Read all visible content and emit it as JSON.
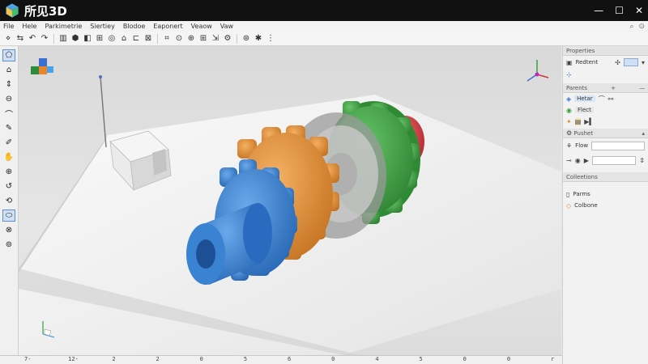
{
  "app": {
    "title": "所见3D"
  },
  "window": {
    "minimize": "—",
    "maximize": "☐",
    "close": "✕"
  },
  "menu": [
    {
      "label": "File",
      "name": "menu-file"
    },
    {
      "label": "Hele",
      "name": "menu-hele"
    },
    {
      "label": "Parkimetrie",
      "name": "menu-parkimetrie"
    },
    {
      "label": "Siertiey",
      "name": "menu-siertiey"
    },
    {
      "label": "Blodoe",
      "name": "menu-blodoe"
    },
    {
      "label": "Eaponert",
      "name": "menu-eaponert"
    },
    {
      "label": "Veaow",
      "name": "menu-veaow"
    },
    {
      "label": "Vaw",
      "name": "menu-vaw"
    }
  ],
  "menu_right": {
    "search_icon": "⌕",
    "pin_icon": "⊙"
  },
  "toolbar": [
    {
      "glyph": "⋄",
      "name": "select-tool-icon"
    },
    {
      "glyph": "⇆",
      "name": "move-tool-icon"
    },
    {
      "glyph": "↶",
      "name": "undo-icon"
    },
    {
      "glyph": "↷",
      "name": "redo-icon"
    },
    {
      "glyph": "▥",
      "name": "grid-icon"
    },
    {
      "glyph": "⬢",
      "name": "solid-icon"
    },
    {
      "glyph": "◧",
      "name": "shade-icon"
    },
    {
      "glyph": "⊞",
      "name": "layout-icon"
    },
    {
      "glyph": "◎",
      "name": "orbit-icon"
    },
    {
      "glyph": "⌂",
      "name": "home-view-icon"
    },
    {
      "glyph": "⊏",
      "name": "frame-icon"
    },
    {
      "glyph": "⊠",
      "name": "bounding-box-icon"
    },
    {
      "glyph": "⌗",
      "name": "mesh-icon"
    },
    {
      "glyph": "⊙",
      "name": "target-icon"
    },
    {
      "glyph": "⊕",
      "name": "add-point-icon"
    },
    {
      "glyph": "⊞",
      "name": "snap-icon"
    },
    {
      "glyph": "⇲",
      "name": "scale-icon"
    },
    {
      "glyph": "⚙",
      "name": "settings-icon"
    },
    {
      "glyph": "⊛",
      "name": "gear-icon"
    },
    {
      "glyph": "✱",
      "name": "light-icon"
    },
    {
      "glyph": "⋮",
      "name": "more-icon"
    }
  ],
  "left_tools": [
    {
      "glyph": "⬠",
      "name": "select-shape-icon",
      "active": true
    },
    {
      "glyph": "⌂",
      "name": "home-icon"
    },
    {
      "glyph": "⇕",
      "name": "pan-icon"
    },
    {
      "glyph": "⊖",
      "name": "zoom-out-icon"
    },
    {
      "glyph": "⌒",
      "name": "arc-icon"
    },
    {
      "glyph": "✎",
      "name": "sketch-icon"
    },
    {
      "glyph": "✐",
      "name": "pen-icon"
    },
    {
      "glyph": "✋",
      "name": "hand-icon"
    },
    {
      "glyph": "⊕",
      "name": "zoom-in-icon"
    },
    {
      "glyph": "↺",
      "name": "rotate-icon"
    },
    {
      "glyph": "⟲",
      "name": "orbit-left-icon"
    },
    {
      "glyph": "⬭",
      "name": "ellipse-icon",
      "active": true
    },
    {
      "glyph": "⊗",
      "name": "section-icon"
    },
    {
      "glyph": "⊚",
      "name": "render-icon"
    }
  ],
  "panel": {
    "properties_header": "Properties",
    "section1_label": "Redtent",
    "section1_btn": "▾",
    "parents_header": "Parents",
    "parent_rows": [
      {
        "label": "Hetar",
        "name": "parent-row-hetar"
      },
      {
        "label": "Flect",
        "name": "parent-row-flect"
      }
    ],
    "pushet_label": "Pushet",
    "flow_label": "Flow",
    "collections_header": "Colleetions",
    "collections": [
      {
        "label": "Parms",
        "name": "collection-parms"
      },
      {
        "label": "Colbone",
        "name": "collection-colbone"
      }
    ],
    "plus": "+",
    "dash": "—",
    "caret": "▴"
  },
  "ruler": [
    "7-",
    "12-",
    "2",
    "2",
    "0",
    "5",
    "6",
    "0",
    "4",
    "5",
    "0",
    "0",
    "r"
  ],
  "colors": {
    "gear_blue": "#2f78c8",
    "gear_orange": "#e08e35",
    "gear_green": "#3a9e3f",
    "end_red": "#d4343a"
  }
}
